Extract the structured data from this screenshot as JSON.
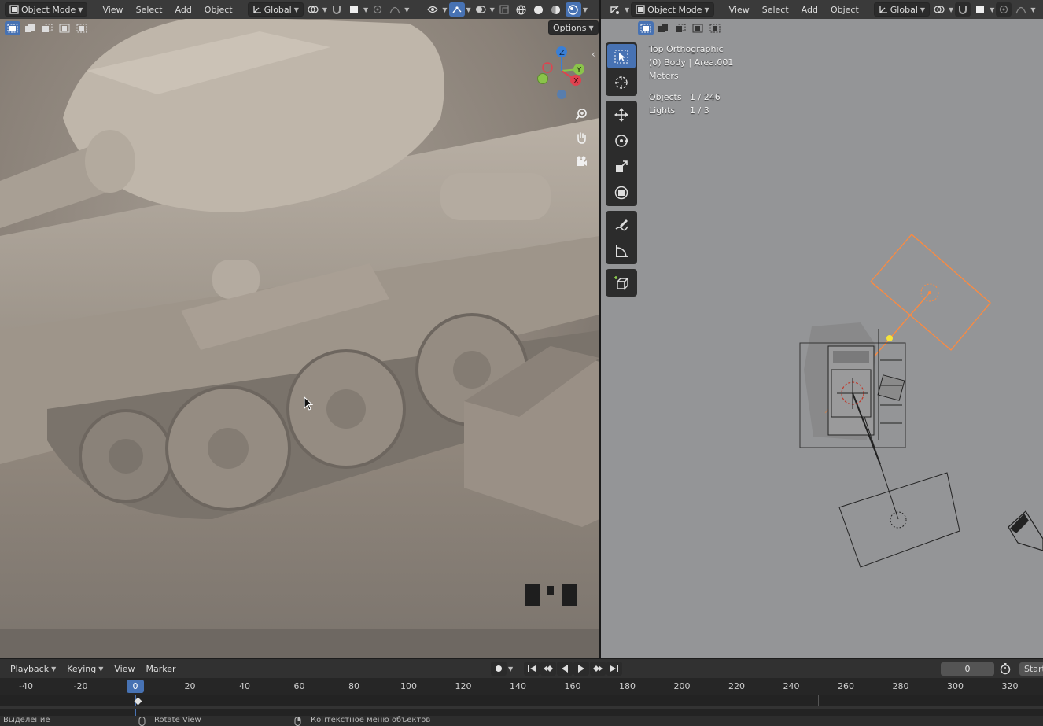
{
  "left_header": {
    "mode": "Object Mode",
    "menus": [
      "View",
      "Select",
      "Add",
      "Object"
    ],
    "orientation": "Global",
    "options_label": "Options"
  },
  "right_header": {
    "mode": "Object Mode",
    "menus": [
      "View",
      "Select",
      "Add",
      "Object"
    ],
    "orientation": "Global"
  },
  "right_view": {
    "view_name": "Top Orthographic",
    "collection": "(0) Body | Area.001",
    "units": "Meters",
    "stats": [
      {
        "label": "Objects",
        "value": "1 / 246"
      },
      {
        "label": "Lights",
        "value": "1 / 3"
      }
    ]
  },
  "timeline": {
    "menus": [
      "Playback",
      "Keying",
      "View",
      "Marker"
    ],
    "current_frame": "0",
    "start_label": "Start",
    "ticks": [
      "-40",
      "-20",
      "0",
      "20",
      "40",
      "60",
      "80",
      "100",
      "120",
      "140",
      "160",
      "180",
      "200",
      "220",
      "240",
      "260",
      "280",
      "300",
      "320"
    ]
  },
  "status_bar": {
    "left": "Выделение",
    "middle": "Rotate View",
    "right": "Контекстное меню объектов"
  },
  "colors": {
    "accent": "#4772b3",
    "light_outline": "#ff8a3d",
    "header_bg": "#3a3a3a"
  }
}
